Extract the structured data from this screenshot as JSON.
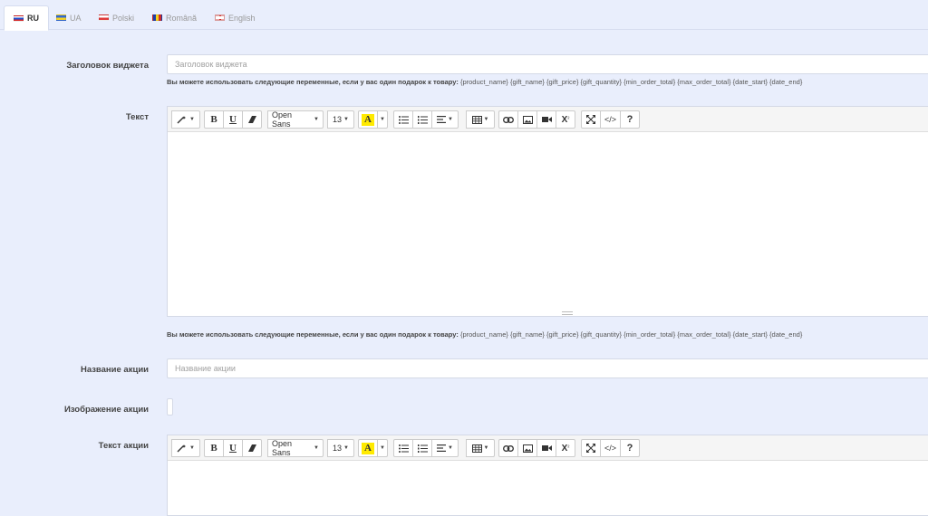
{
  "tabs": [
    {
      "label": "RU",
      "flag": "flag-ru",
      "active": true
    },
    {
      "label": "UA",
      "flag": "flag-ua",
      "active": false
    },
    {
      "label": "Polski",
      "flag": "flag-pl",
      "active": false
    },
    {
      "label": "Română",
      "flag": "flag-ro",
      "active": false
    },
    {
      "label": "English",
      "flag": "flag-en",
      "active": false
    }
  ],
  "form": {
    "widget_title": {
      "label": "Заголовок виджета",
      "placeholder": "Заголовок виджета",
      "value": ""
    },
    "hint": {
      "lead": "Вы можете использовать следующие переменные, если у вас один подарок к товару:",
      "vars": "{product_name} {gift_name} {gift_price} {gift_quantity} {min_order_total} {max_order_total} {date_start} {date_end}"
    },
    "text": {
      "label": "Текст"
    },
    "promo_name": {
      "label": "Название акции",
      "placeholder": "Название акции",
      "value": ""
    },
    "promo_image": {
      "label": "Изображение акции"
    },
    "promo_text": {
      "label": "Текст акции"
    }
  },
  "toolbar": {
    "font_family": "Open Sans",
    "font_size": "13",
    "highlight_letter": "A",
    "superscript": "X",
    "superscript_mark": "²",
    "code": "</>",
    "help": "?",
    "icons": [
      "magic-wand-icon",
      "bold-icon",
      "underline-icon",
      "eraser-icon",
      "font-family-dropdown",
      "font-size-dropdown",
      "highlight-color-icon",
      "bullet-list-icon",
      "numbered-list-icon",
      "align-icon",
      "table-icon",
      "link-icon",
      "picture-icon",
      "video-icon",
      "superscript-icon",
      "fullscreen-icon",
      "code-view-icon",
      "help-icon"
    ]
  },
  "colors": {
    "page_bg": "#e9eefc",
    "highlight": "#ffea00",
    "border": "#d4d9e6"
  }
}
